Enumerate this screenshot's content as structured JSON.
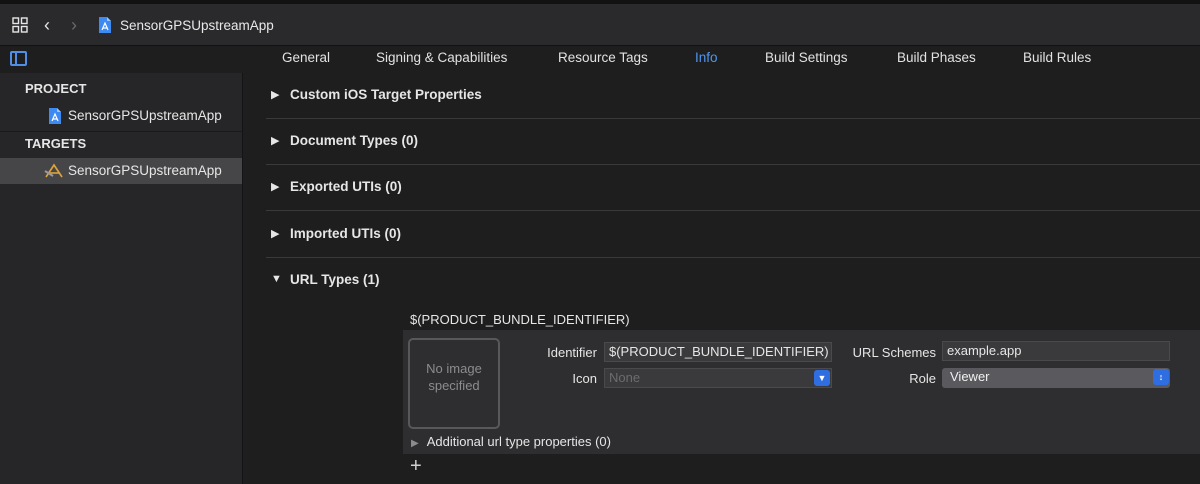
{
  "topbar": {
    "title": "SensorGPSUpstreamApp",
    "back_icon": "chevron-left-icon",
    "forward_icon": "chevron-right-icon"
  },
  "tabs": [
    {
      "label": "General"
    },
    {
      "label": "Signing & Capabilities"
    },
    {
      "label": "Resource Tags"
    },
    {
      "label": "Info",
      "active": true
    },
    {
      "label": "Build Settings"
    },
    {
      "label": "Build Phases"
    },
    {
      "label": "Build Rules"
    }
  ],
  "sidebar": {
    "project_header": "PROJECT",
    "project_item": "SensorGPSUpstreamApp",
    "targets_header": "TARGETS",
    "target_item": "SensorGPSUpstreamApp"
  },
  "sections": [
    {
      "title": "Custom iOS Target Properties",
      "expanded": false
    },
    {
      "title": "Document Types (0)",
      "expanded": false
    },
    {
      "title": "Exported UTIs (0)",
      "expanded": false
    },
    {
      "title": "Imported UTIs (0)",
      "expanded": false
    },
    {
      "title": "URL Types (1)",
      "expanded": true
    }
  ],
  "url_type": {
    "heading": "$(PRODUCT_BUNDLE_IDENTIFIER)",
    "no_image": "No image specified",
    "identifier_label": "Identifier",
    "identifier_value": "$(PRODUCT_BUNDLE_IDENTIFIER)",
    "icon_label": "Icon",
    "icon_placeholder": "None",
    "url_schemes_label": "URL Schemes",
    "url_schemes_value": "example.app",
    "role_label": "Role",
    "role_value": "Viewer",
    "additional": "Additional url type properties (0)",
    "add_button": "+"
  },
  "colors": {
    "accent": "#4f97f0",
    "selection": "#464649",
    "popup_blue": "#2f6ee0"
  }
}
